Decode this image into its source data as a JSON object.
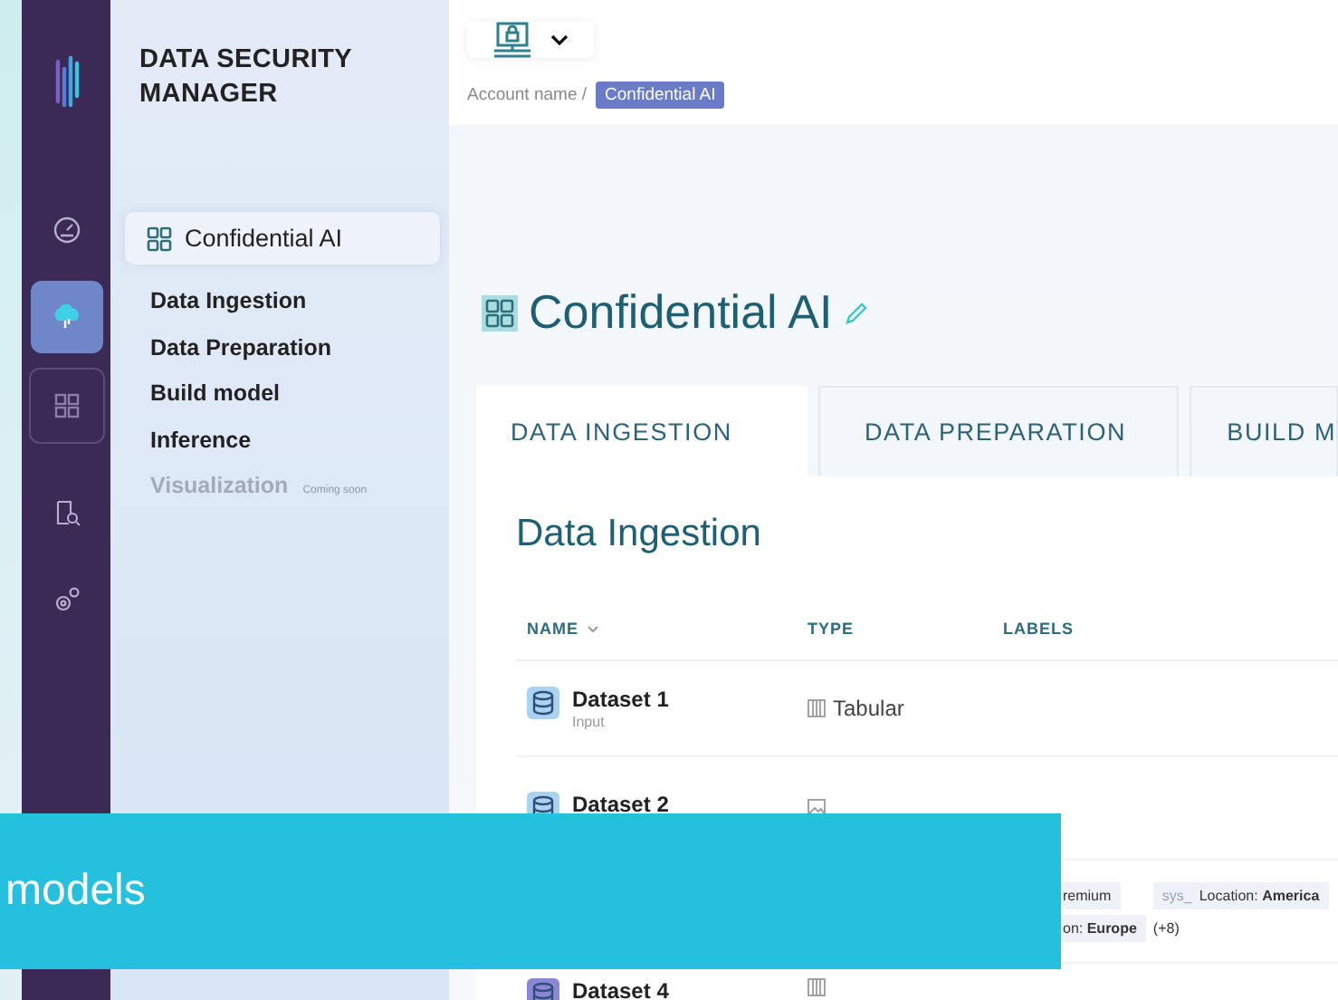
{
  "app": {
    "title": "DATA SECURITY MANAGER"
  },
  "rail": [
    {
      "selected": false
    },
    {
      "selected": true
    },
    {
      "selected": false
    },
    {
      "selected": false
    },
    {
      "selected": false
    }
  ],
  "sidebar": {
    "project": {
      "label": "Confidential AI",
      "selected": true
    },
    "items": [
      {
        "label": "Data Ingestion",
        "disabled": false
      },
      {
        "label": "Data Preparation",
        "disabled": false
      },
      {
        "label": "Build model",
        "disabled": false
      },
      {
        "label": "Inference",
        "disabled": false
      },
      {
        "label": "Visualization",
        "disabled": true,
        "note": "Coming soon"
      }
    ]
  },
  "breadcrumb": {
    "parent": "Account name /",
    "current": "Confidential AI"
  },
  "page": {
    "title": "Confidential AI"
  },
  "tabs": [
    {
      "label": "DATA INGESTION",
      "selected": true
    },
    {
      "label": "DATA PREPARATION",
      "selected": false
    },
    {
      "label": "BUILD M",
      "selected": false
    }
  ],
  "section": {
    "title": "Data Ingestion"
  },
  "table": {
    "columns": [
      {
        "label": "NAME",
        "sortable": true
      },
      {
        "label": "TYPE",
        "sortable": false
      },
      {
        "label": "LABELS",
        "sortable": false
      }
    ],
    "rows": [
      {
        "name": "Dataset 1",
        "role": "Input",
        "type": "Tabular",
        "kind": "tabular"
      },
      {
        "name": "Dataset 2",
        "kind": "image"
      },
      {
        "labels": [
          {
            "text": "remium"
          },
          {
            "prefix": "sys_",
            "text": "Location: **America**"
          },
          {
            "text": "on: **Europe**"
          }
        ],
        "more": "(+8)"
      },
      {
        "name": "Dataset 4",
        "kind": "tabular"
      }
    ]
  },
  "caption": {
    "text": "models"
  }
}
